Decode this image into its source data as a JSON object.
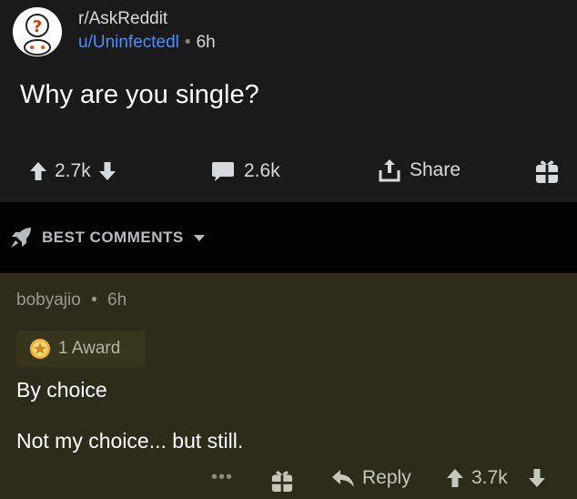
{
  "post": {
    "subreddit": "r/AskReddit",
    "author": "u/Uninfectedl",
    "separator": "•",
    "age": "6h",
    "title": "Why are you single?",
    "score": "2.7k",
    "comment_count": "2.6k",
    "share_label": "Share"
  },
  "sort": {
    "label": "BEST COMMENTS"
  },
  "comment": {
    "author": "bobyajio",
    "separator": "•",
    "age": "6h",
    "award_label": "1 Award",
    "body_line1": "By choice",
    "body_line2": "Not my choice... but still.",
    "more_label": "•••",
    "reply_label": "Reply",
    "score": "3.7k"
  },
  "colors": {
    "background": "#1a1a1b",
    "sort_band": "#030303",
    "comment_highlight": "#2e2b1a",
    "author_link": "#4f8ff7"
  },
  "icons": [
    "askreddit-avatar-icon",
    "upvote-icon",
    "downvote-icon",
    "comment-icon",
    "share-icon",
    "gift-icon",
    "rocket-icon",
    "caret-down-icon",
    "award-icon",
    "reply-icon",
    "more-icon"
  ]
}
